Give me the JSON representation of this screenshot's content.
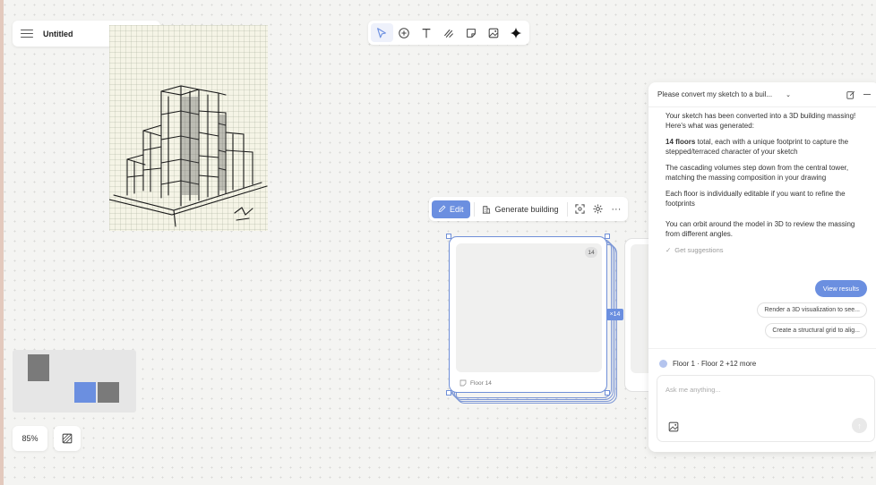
{
  "document": {
    "title": "Untitled"
  },
  "toolbar": {
    "tools": [
      "select-icon",
      "add-icon",
      "text-icon",
      "draw-icon",
      "sticky-note-icon",
      "image-icon",
      "ai-sparkle-icon"
    ],
    "active_tool": "select"
  },
  "canvas": {
    "zoom": "85%",
    "editbar": {
      "edit_label": "Edit",
      "generate_label": "Generate building",
      "more_label": "···"
    },
    "card": {
      "count": "14",
      "label": "Floor 14",
      "stack_badge": "×14"
    }
  },
  "chat": {
    "header_title": "Please convert my sketch to a buil...",
    "intro": "Your sketch has been converted into a 3D building massing! Here's what was generated:",
    "point1_bold": "14 floors",
    "point1_rest": " total, each with a unique footprint to capture the stepped/terraced character of your sketch",
    "point2": "The cascading volumes step down from the central tower, matching the massing composition in your drawing",
    "point3": "Each floor is individually editable if you want to refine the footprints",
    "point4": "You can orbit around the model in 3D to review the massing from different angles.",
    "suggestions_label": "Get suggestions",
    "view_results_label": "View results",
    "suggestion1": "Render a 3D visualization to see...",
    "suggestion2": "Create a structural grid to alig...",
    "context_label": "Floor 1 · Floor 2 +12 more",
    "input_placeholder": "Ask me anything..."
  },
  "colors": {
    "accent": "#6b8fe0",
    "background": "#f4f4f2"
  }
}
